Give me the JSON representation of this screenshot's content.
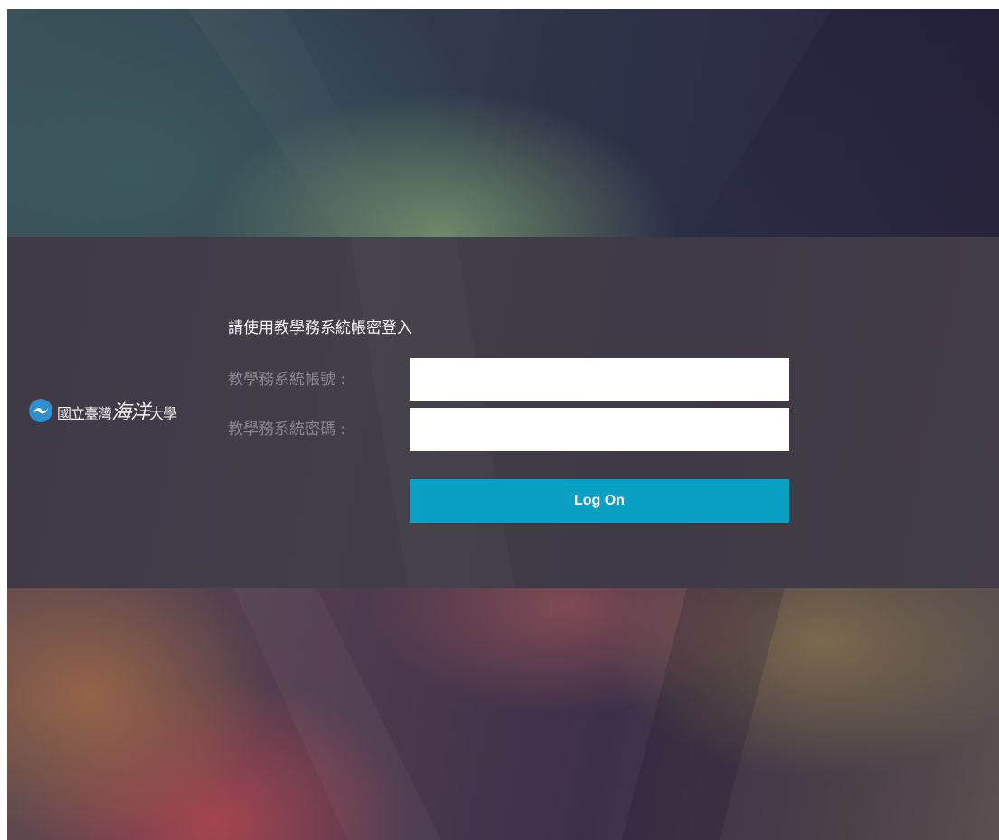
{
  "logo": {
    "icon": "wave-emblem-icon",
    "text_prefix": "國立臺灣",
    "text_big": "海洋",
    "text_suffix": "大學"
  },
  "login": {
    "prompt": "請使用教學務系統帳密登入",
    "account_label": "教學務系統帳號 :",
    "account_value": "",
    "password_label": "教學務系統密碼 :",
    "password_value": "",
    "submit_label": "Log On"
  },
  "colors": {
    "button": "#0aa0c4",
    "band": "#403b46",
    "emblem": "#2b8fd0"
  }
}
